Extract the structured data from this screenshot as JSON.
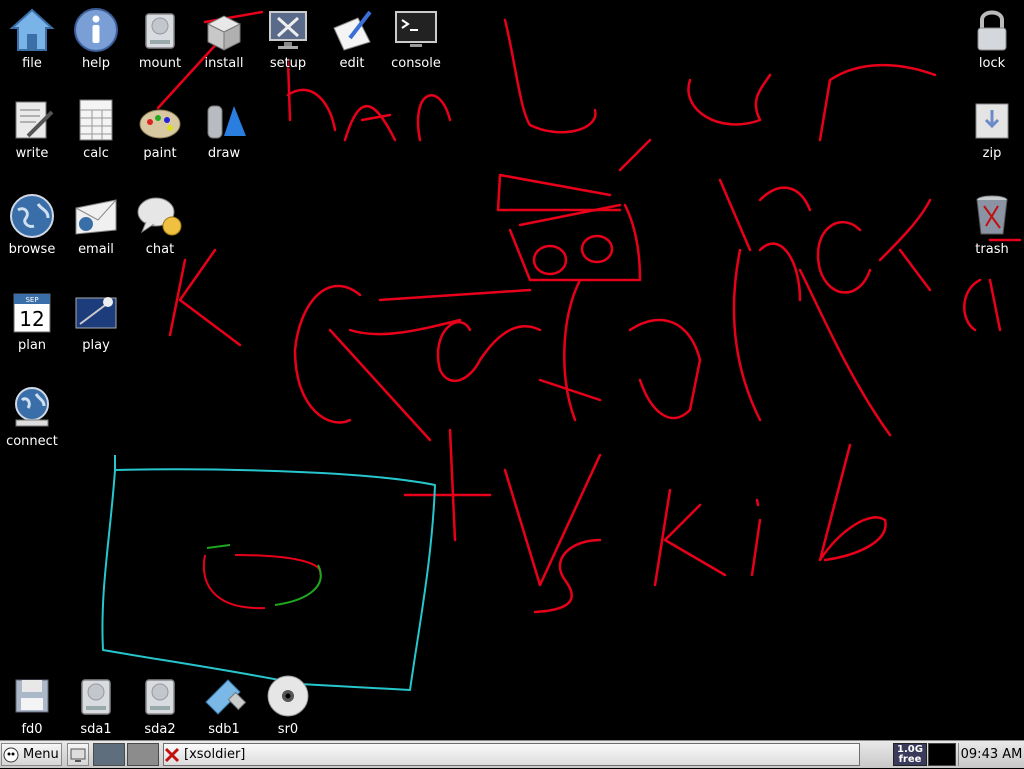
{
  "desktop": {
    "background": "#000000",
    "drawing_colors": {
      "primary": "#e8001a",
      "box": "#27c6cc",
      "accent": "#1fa51f"
    },
    "icons_top": [
      "file",
      "help",
      "mount",
      "install",
      "setup",
      "edit",
      "console"
    ],
    "icons_left": [
      "write",
      "calc",
      "paint",
      "draw",
      "browse",
      "email",
      "chat",
      "plan",
      "play",
      "connect"
    ],
    "icons_right": [
      "lock",
      "zip",
      "trash"
    ],
    "icons_drives": [
      "fd0",
      "sda1",
      "sda2",
      "sdb1",
      "sr0"
    ],
    "calendar_icon": {
      "month": "SEP",
      "day": "12"
    }
  },
  "taskbar": {
    "menu_label": "Menu",
    "task_title": "[xsoldier]",
    "memory_value": "1.0G",
    "memory_label": "free",
    "clock": "09:43 AM"
  }
}
